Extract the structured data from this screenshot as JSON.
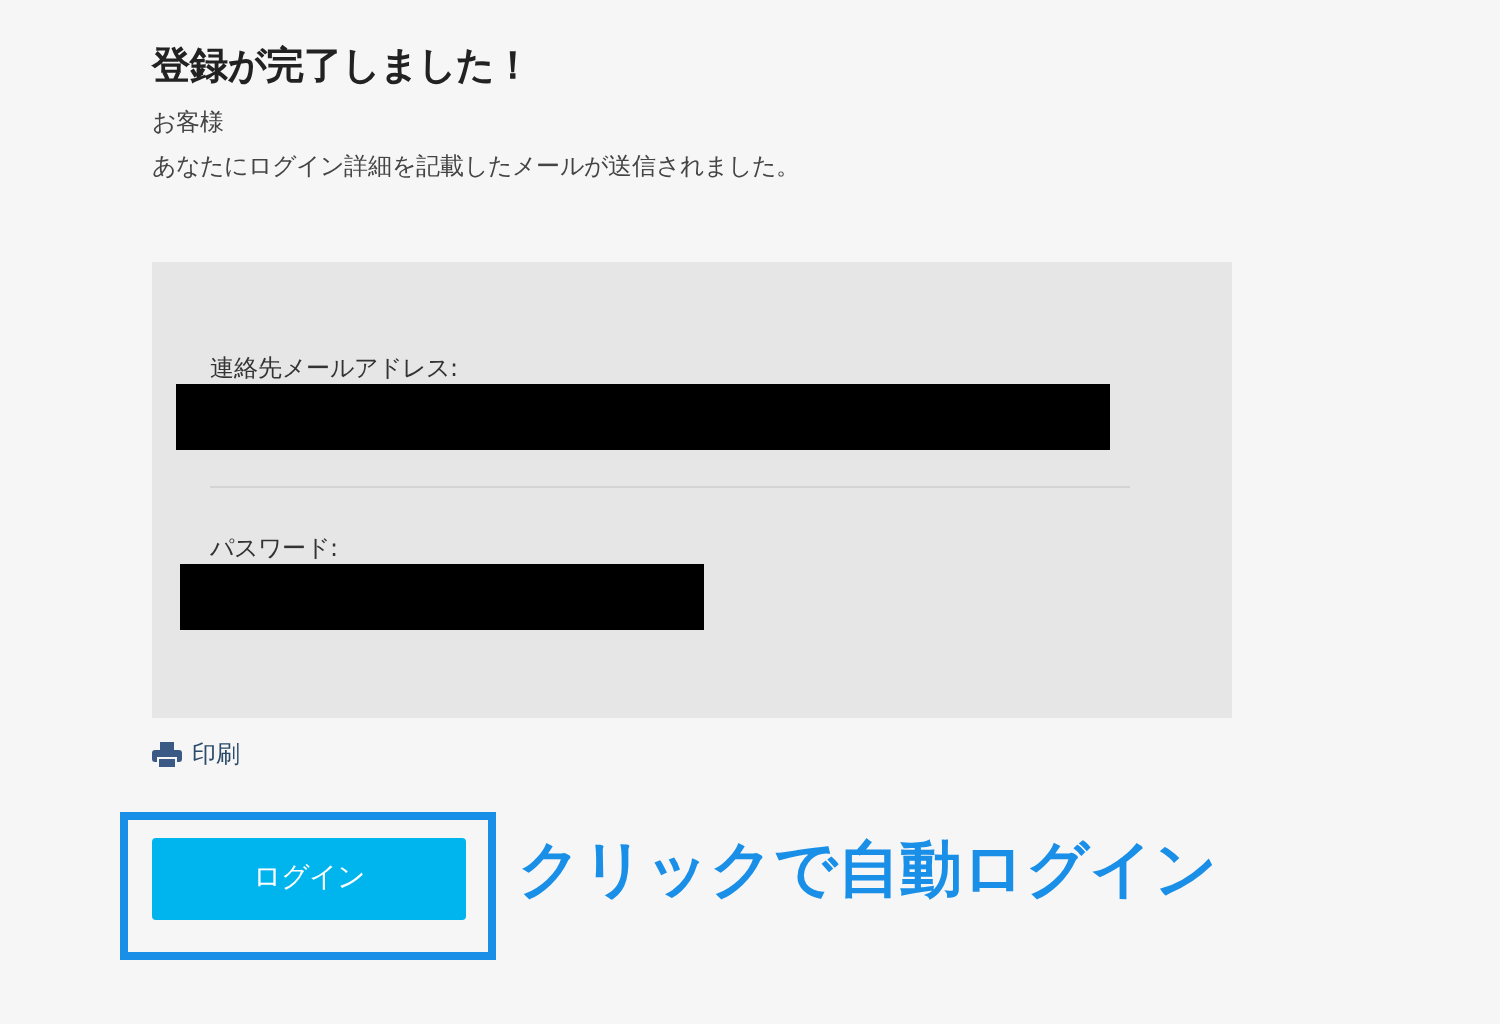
{
  "title": "登録が完了しました！",
  "greeting": "お客様",
  "message": "あなたにログイン詳細を記載したメールが送信されました。",
  "details": [
    {
      "label": "連絡先メールアドレス:"
    },
    {
      "label": "パスワード:"
    }
  ],
  "print_link": "印刷",
  "login_button": "ログイン",
  "annotation": "クリックで自動ログイン"
}
